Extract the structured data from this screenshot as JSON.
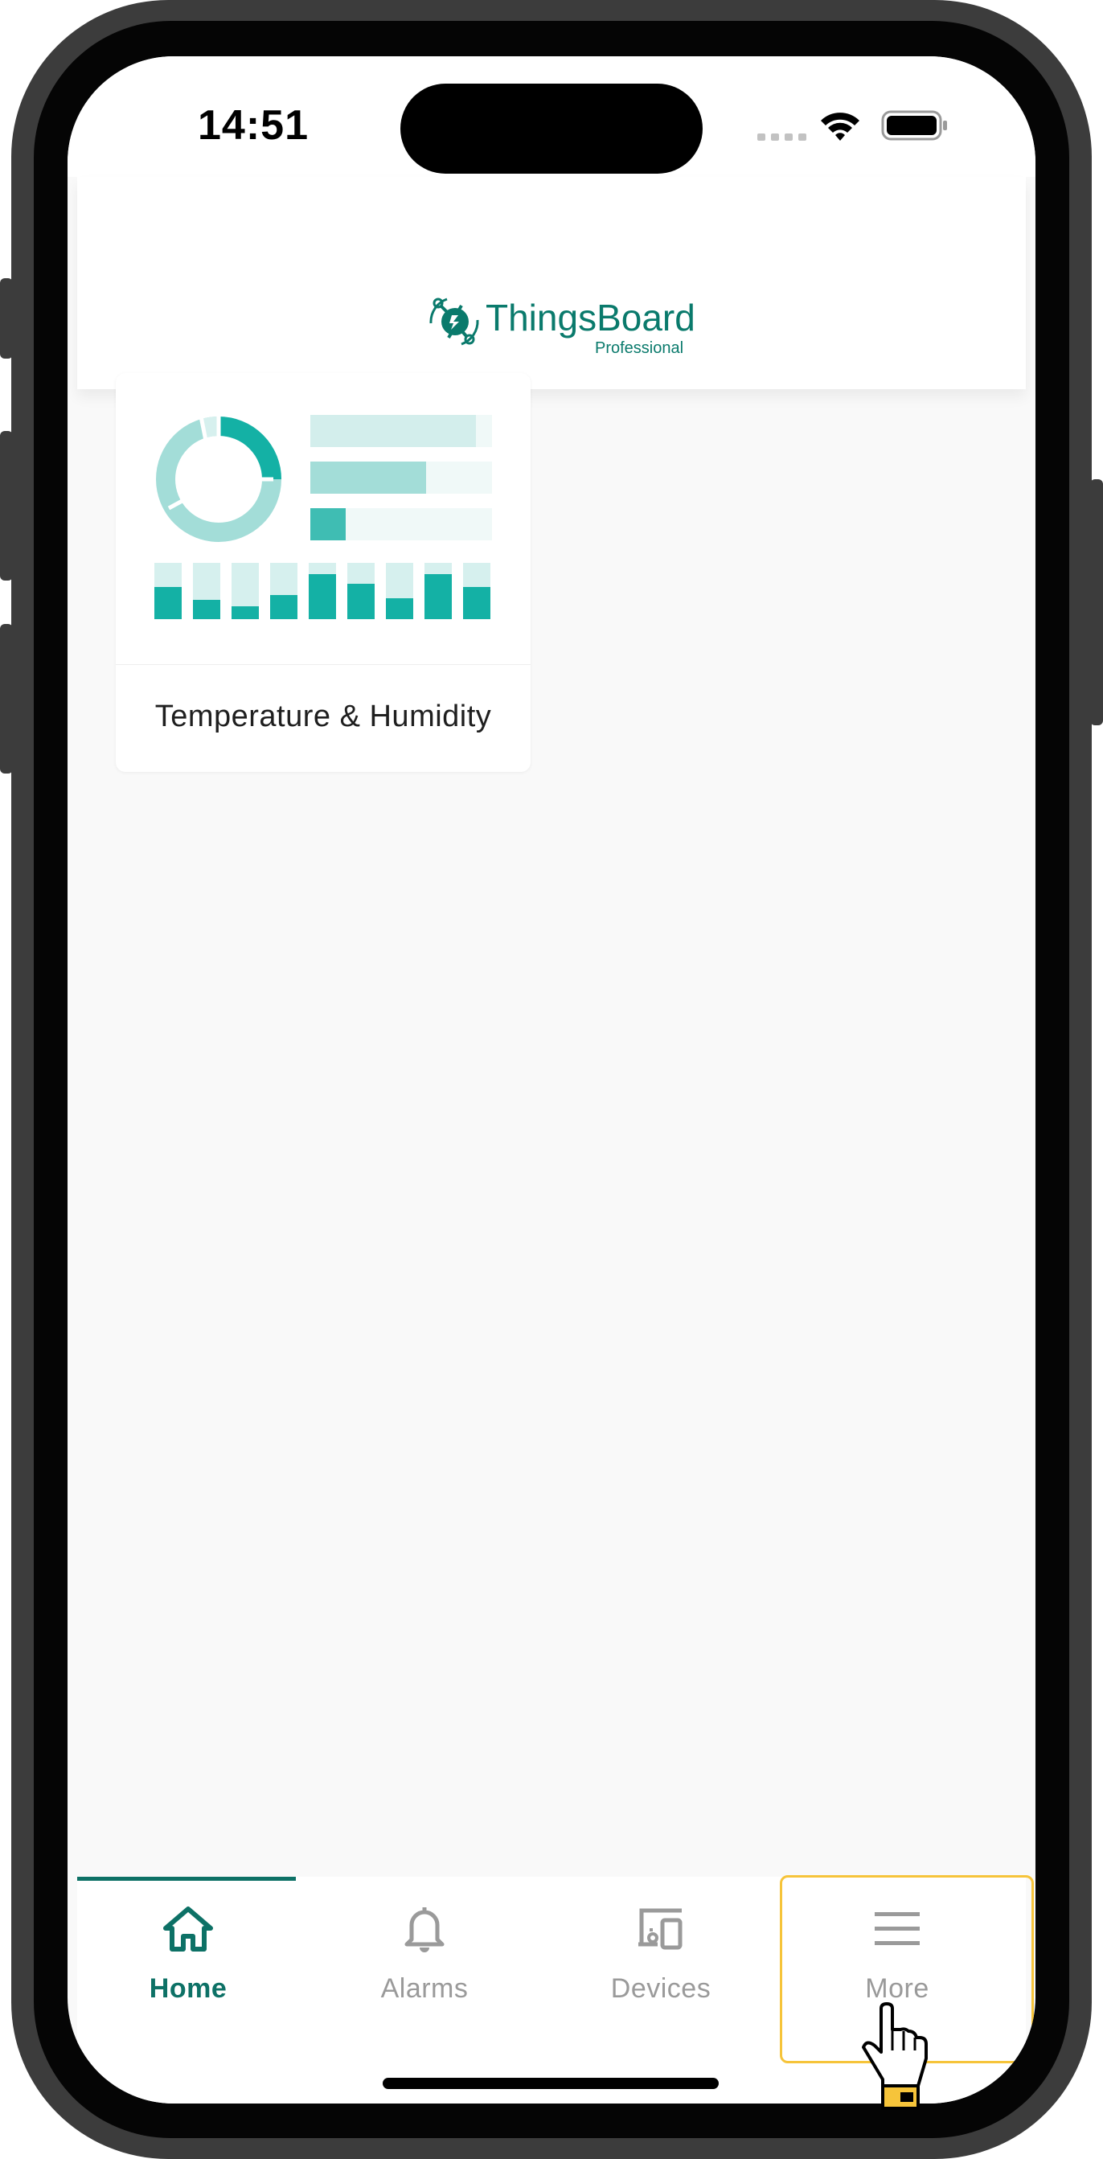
{
  "status_bar": {
    "time": "14:51",
    "icons": [
      "signal-dots-icon",
      "wifi-icon",
      "battery-icon"
    ]
  },
  "header": {
    "logo_text": "ThingsBoard",
    "logo_subtext": "Professional"
  },
  "dashboards": [
    {
      "title": "Temperature & Humidity",
      "thumbnail": "dashboard-preview-icon"
    }
  ],
  "bottom_nav": {
    "active": "Home",
    "items": [
      {
        "label": "Home",
        "icon": "home-icon"
      },
      {
        "label": "Alarms",
        "icon": "bell-icon"
      },
      {
        "label": "Devices",
        "icon": "devices-icon"
      },
      {
        "label": "More",
        "icon": "menu-icon"
      }
    ]
  },
  "colors": {
    "brand": "#0a7a6c",
    "active_nav": "#0d7166",
    "inactive_nav": "#9a9a9a",
    "highlight": "#f6c43a",
    "chart_teal": "#14b1a5"
  }
}
